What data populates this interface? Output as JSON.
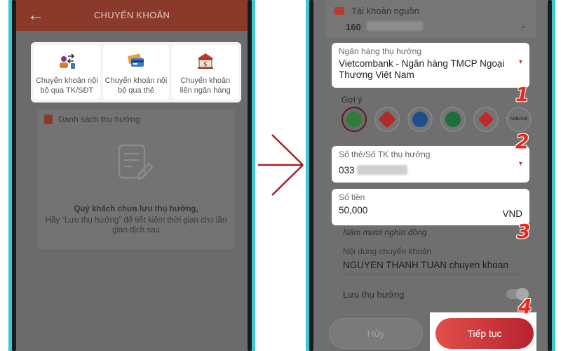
{
  "left_screen": {
    "header": {
      "title": "CHUYỂN KHOẢN",
      "back_icon": "arrow-left-icon"
    },
    "transfer_options": [
      {
        "label": "Chuyển khoản nội bộ qua TK/SĐT",
        "icon": "internal-transfer-icon"
      },
      {
        "label": "Chuyển khoản nội bộ qua thẻ",
        "icon": "card-transfer-icon"
      },
      {
        "label": "Chuyển khoản liên ngân hàng",
        "icon": "bank-building-icon"
      }
    ],
    "beneficiaries": {
      "title": "Danh sách thụ hưởng",
      "empty_title": "Quý khách chưa lưu thụ hưởng,",
      "empty_desc": "Hãy “Lưu thụ hưởng” để tiết kiệm thời gian cho lần giao dịch sau"
    }
  },
  "right_screen": {
    "source_account": {
      "label": "Tài khoản nguồn",
      "value": "160"
    },
    "beneficiary_bank": {
      "label": "Ngân hàng thụ hưởng",
      "value": "Vietcombank - Ngân hàng TMCP Ngoại Thương Việt Nam"
    },
    "suggestions": {
      "label": "Gợi ý",
      "banks": [
        {
          "name": "vietcombank-logo-icon",
          "color": "#2f7d3a",
          "text": ""
        },
        {
          "name": "agribank-logo-icon",
          "color": "#b02a2a",
          "text": ""
        },
        {
          "name": "vietinbank-logo-icon",
          "color": "#1f4e8c",
          "text": ""
        },
        {
          "name": "bidv-logo-icon",
          "color": "#1e6e3a",
          "text": ""
        },
        {
          "name": "techcombank-logo-icon",
          "color": "#c0282c",
          "text": ""
        },
        {
          "name": "abbank-logo-icon",
          "color": "#7a7a7a",
          "text": "ABBANK"
        }
      ]
    },
    "account_number": {
      "label": "Số thẻ/Số TK thụ hưởng",
      "value": "033"
    },
    "amount": {
      "label": "Số tiền",
      "value": "50,000",
      "currency": "VND",
      "in_words": "Năm mươi nghìn đồng"
    },
    "content": {
      "label": "Nội dung chuyển khoản",
      "value": "NGUYEN THANH TUAN chuyen khoan"
    },
    "save_beneficiary": {
      "label": "Lưu thụ hưởng",
      "enabled": false
    },
    "buttons": {
      "cancel": "Hủy",
      "next": "Tiếp tục"
    }
  },
  "steps": [
    "1",
    "2",
    "3",
    "4"
  ],
  "colors": {
    "accent_red": "#e8281e",
    "header_brown": "#8a3a2a",
    "phone_frame": "#3fc6d0",
    "button_red": "#c8303a"
  }
}
